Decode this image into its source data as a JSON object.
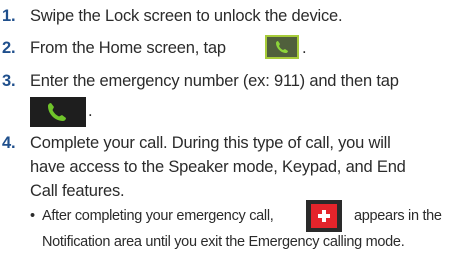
{
  "steps": [
    {
      "number": "1.",
      "text": "Swipe the Lock screen to unlock the device."
    },
    {
      "number": "2.",
      "text_before": "From the Home screen, tap",
      "text_after": "."
    },
    {
      "number": "3.",
      "line1": "Enter the emergency number (ex: 911) and then tap",
      "line2_after": "."
    },
    {
      "number": "4.",
      "line1": "Complete your call. During this type of call, you will",
      "line2": "have access to the Speaker mode, Keypad, and End",
      "line3": "Call features."
    }
  ],
  "bullet": {
    "symbol": "•",
    "text_before": "After completing your emergency call,",
    "text_after": "appears in the",
    "line2": "Notification area until you exit the Emergency calling mode."
  },
  "icons": {
    "phone_small": "phone-app-icon",
    "phone_large": "call-button-icon",
    "emergency": "emergency-plus-icon"
  },
  "colors": {
    "step_number": "#1f4f8c",
    "body_text": "#2b2b2b",
    "phone_green": "#6fc42a",
    "emergency_red": "#e4242b"
  }
}
